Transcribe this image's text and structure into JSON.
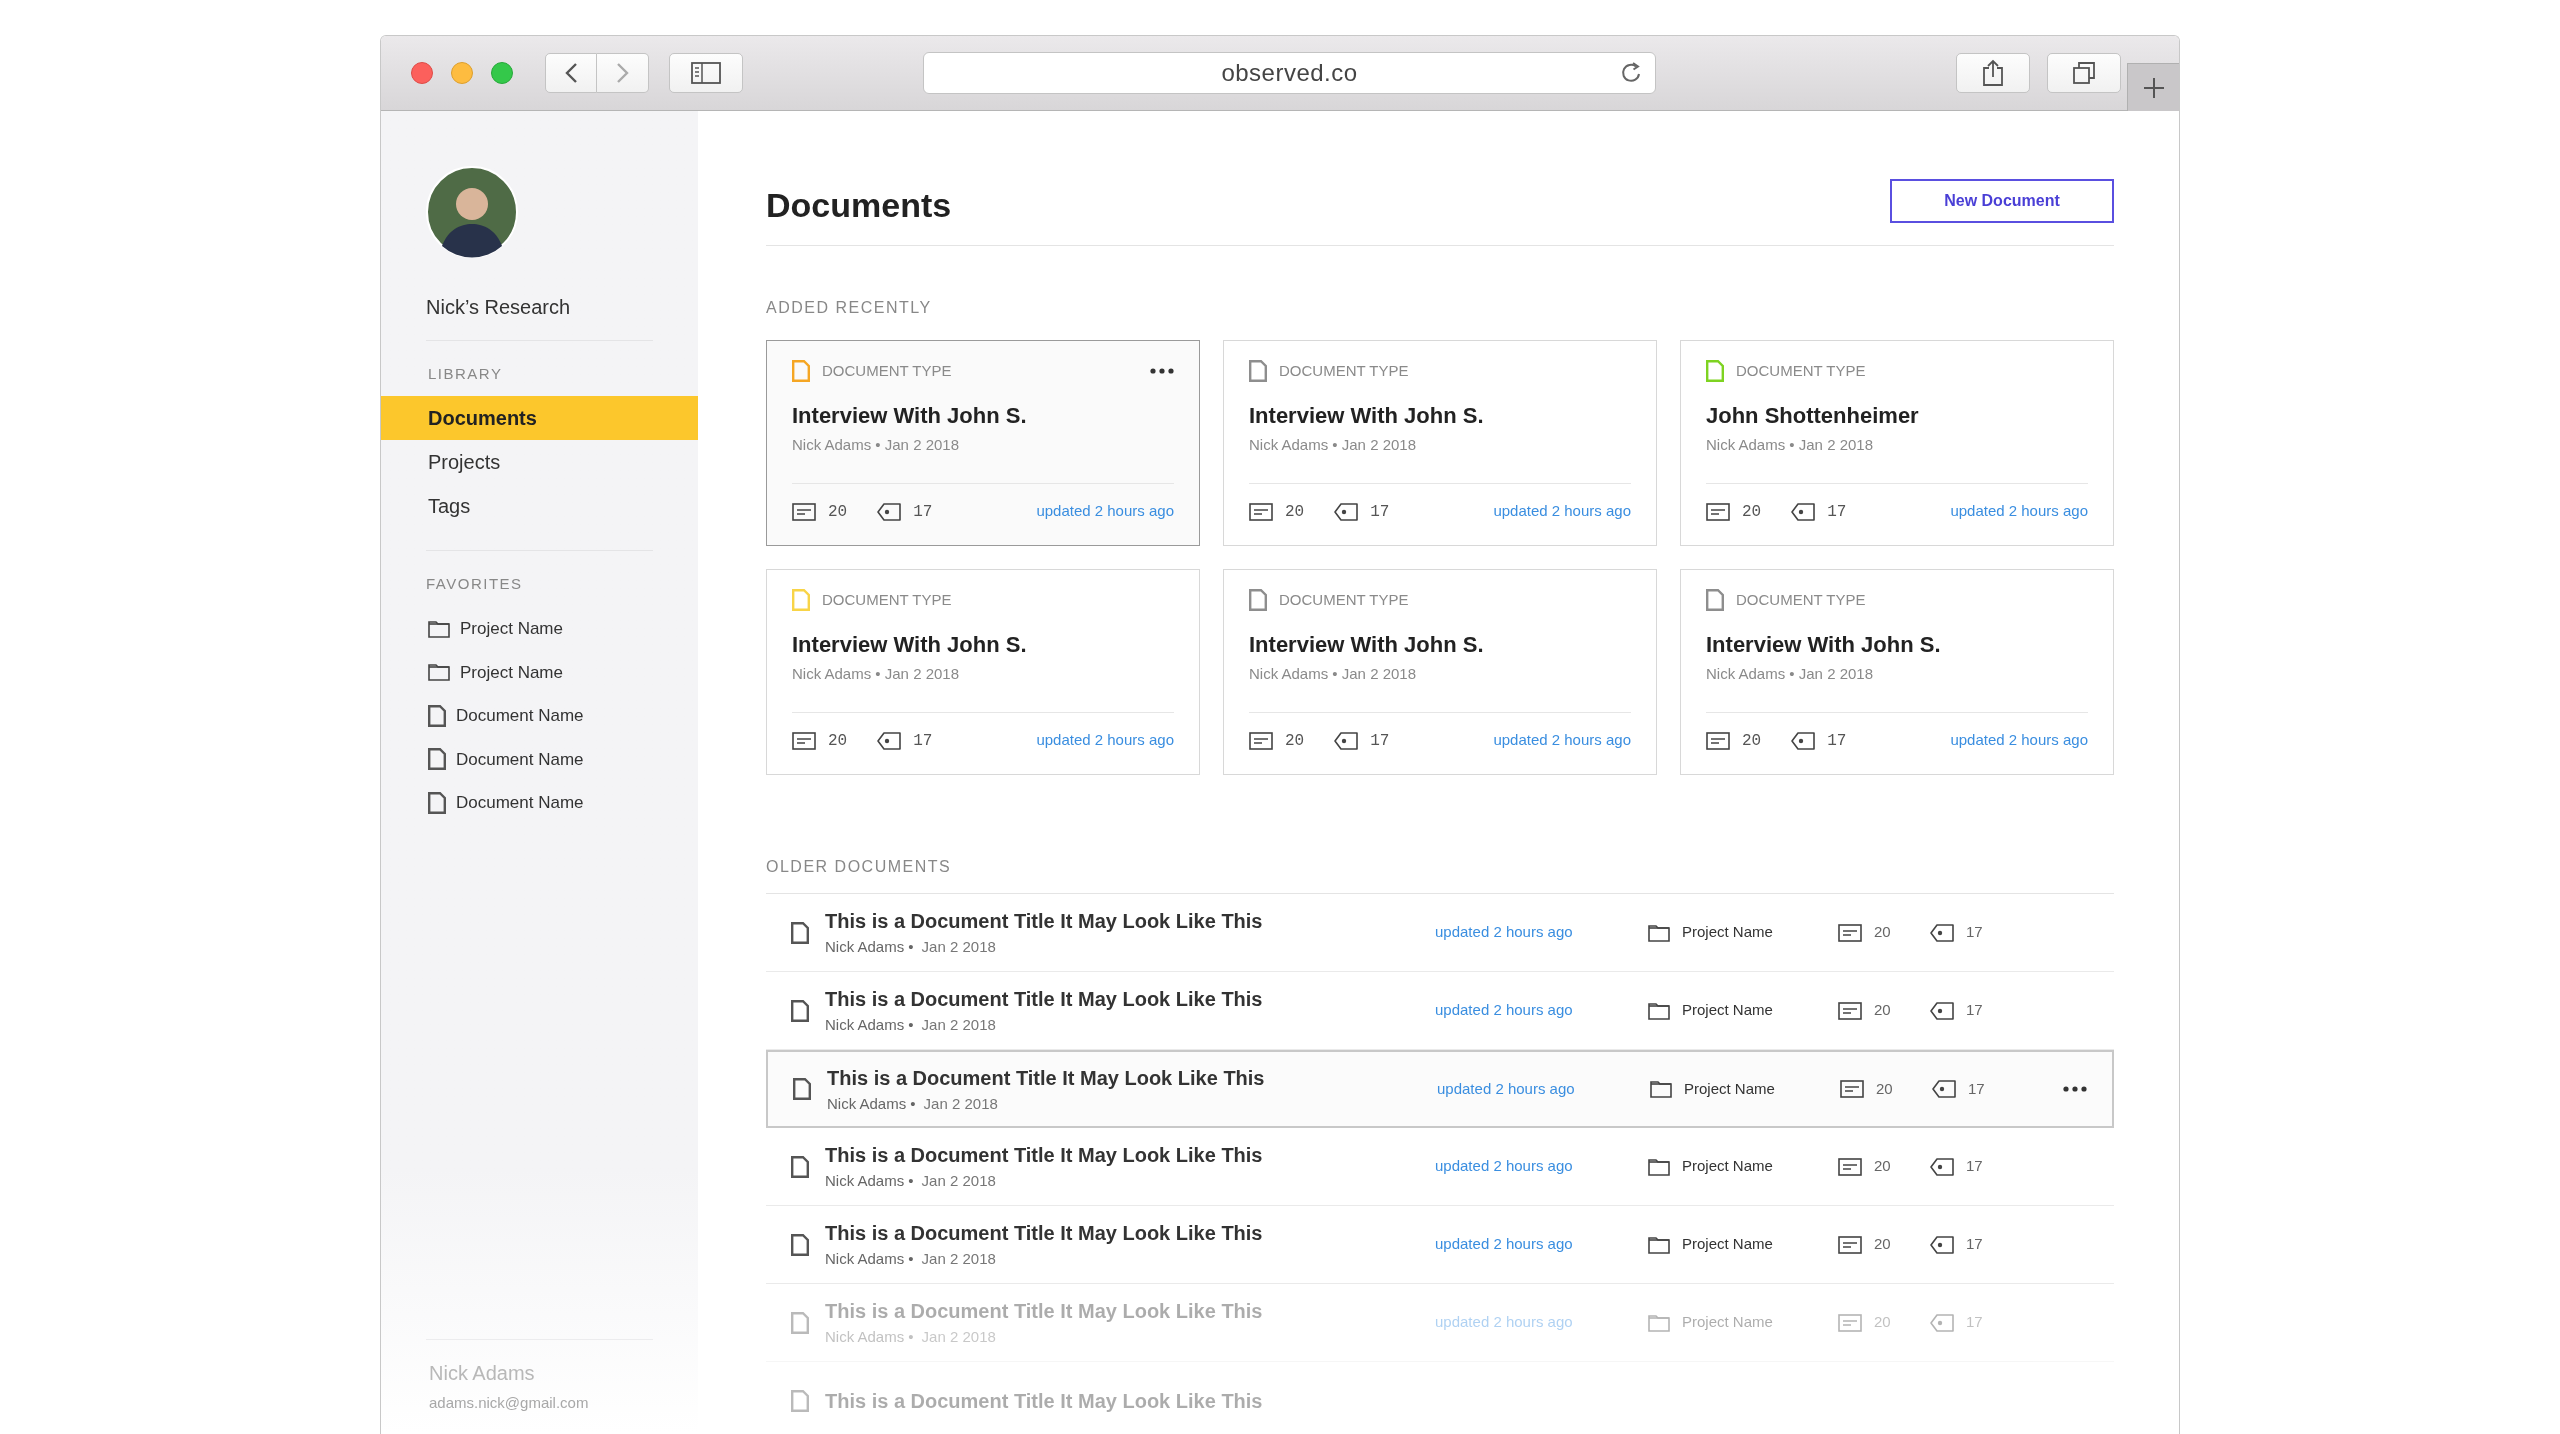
{
  "browser": {
    "url": "observed.co"
  },
  "sidebar": {
    "workspace": "Nick’s Research",
    "library_label": "LIBRARY",
    "library": [
      {
        "label": "Documents",
        "selected": true
      },
      {
        "label": "Projects",
        "selected": false
      },
      {
        "label": "Tags",
        "selected": false
      }
    ],
    "favorites_label": "FAVORITES",
    "favorites": [
      {
        "label": "Project Name",
        "kind": "folder"
      },
      {
        "label": "Project Name",
        "kind": "folder"
      },
      {
        "label": "Document Name",
        "kind": "document"
      },
      {
        "label": "Document Name",
        "kind": "document"
      },
      {
        "label": "Document Name",
        "kind": "document"
      }
    ],
    "user": {
      "name": "Nick Adams",
      "email": "adams.nick@gmail.com"
    }
  },
  "header": {
    "title": "Documents",
    "button": "New Document"
  },
  "recent": {
    "label": "ADDED RECENTLY",
    "cards": [
      {
        "type": "DOCUMENT TYPE",
        "title": "Interview With John S.",
        "meta": "Nick Adams • Jan 2 2018",
        "comments": "20",
        "tags": "17",
        "updated": "updated 2 hours ago",
        "color": "#f5a623",
        "selected": true
      },
      {
        "type": "DOCUMENT TYPE",
        "title": "Interview With John S.",
        "meta": "Nick Adams • Jan 2 2018",
        "comments": "20",
        "tags": "17",
        "updated": "updated 2 hours ago",
        "color": "#8e8e8e",
        "selected": false
      },
      {
        "type": "DOCUMENT TYPE",
        "title": "John Shottenheimer",
        "meta": "Nick Adams • Jan 2 2018",
        "comments": "20",
        "tags": "17",
        "updated": "updated 2 hours ago",
        "color": "#7ed321",
        "selected": false
      },
      {
        "type": "DOCUMENT TYPE",
        "title": "Interview With John S.",
        "meta": "Nick Adams • Jan 2 2018",
        "comments": "20",
        "tags": "17",
        "updated": "updated 2 hours ago",
        "color": "#f8d447",
        "selected": false
      },
      {
        "type": "DOCUMENT TYPE",
        "title": "Interview With John S.",
        "meta": "Nick Adams • Jan 2 2018",
        "comments": "20",
        "tags": "17",
        "updated": "updated 2 hours ago",
        "color": "#8e8e8e",
        "selected": false
      },
      {
        "type": "DOCUMENT TYPE",
        "title": "Interview With John S.",
        "meta": "Nick Adams • Jan 2 2018",
        "comments": "20",
        "tags": "17",
        "updated": "updated 2 hours ago",
        "color": "#8e8e8e",
        "selected": false
      }
    ]
  },
  "older": {
    "label": "OLDER DOCUMENTS",
    "rows": [
      {
        "title": "This is a Document Title It May Look Like This",
        "author": "Nick Adams •",
        "date": "Jan 2 2018",
        "updated": "updated 2 hours ago",
        "project": "Project Name",
        "comments": "20",
        "tags": "17",
        "selected": false,
        "dimmed": false
      },
      {
        "title": "This is a Document Title It May Look Like This",
        "author": "Nick Adams •",
        "date": "Jan 2 2018",
        "updated": "updated 2 hours ago",
        "project": "Project Name",
        "comments": "20",
        "tags": "17",
        "selected": false,
        "dimmed": false
      },
      {
        "title": "This is a Document Title It May Look Like This",
        "author": "Nick Adams •",
        "date": "Jan 2 2018",
        "updated": "updated 2 hours ago",
        "project": "Project Name",
        "comments": "20",
        "tags": "17",
        "selected": true,
        "dimmed": false
      },
      {
        "title": "This is a Document Title It May Look Like This",
        "author": "Nick Adams •",
        "date": "Jan 2 2018",
        "updated": "updated 2 hours ago",
        "project": "Project Name",
        "comments": "20",
        "tags": "17",
        "selected": false,
        "dimmed": false
      },
      {
        "title": "This is a Document Title It May Look Like This",
        "author": "Nick Adams •",
        "date": "Jan 2 2018",
        "updated": "updated 2 hours ago",
        "project": "Project Name",
        "comments": "20",
        "tags": "17",
        "selected": false,
        "dimmed": false
      },
      {
        "title": "This is a Document Title It May Look Like This",
        "author": "Nick Adams •",
        "date": "Jan 2 2018",
        "updated": "updated 2 hours ago",
        "project": "Project Name",
        "comments": "20",
        "tags": "17",
        "selected": false,
        "dimmed": true
      },
      {
        "title": "This is a Document Title It May Look Like This",
        "selected": false,
        "dimmed": true
      }
    ]
  }
}
